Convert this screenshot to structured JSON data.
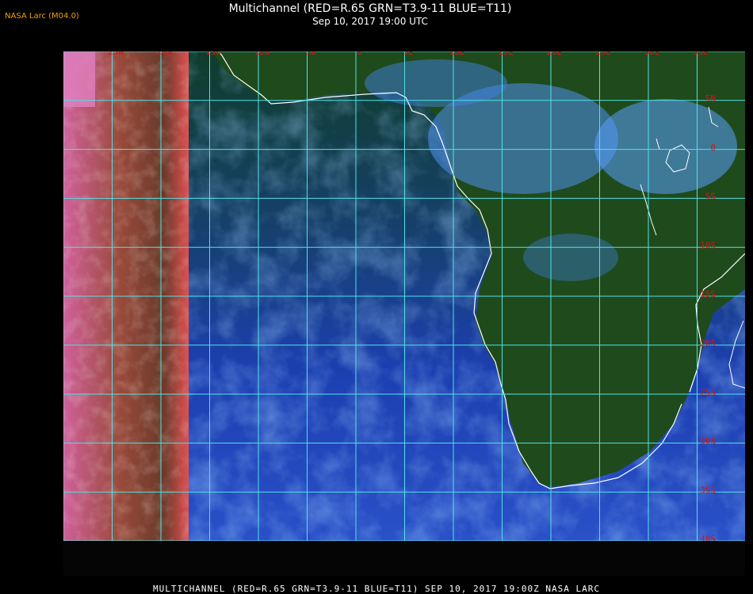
{
  "credit": "NASA Larc (M04.0)",
  "title": "Multichannel (RED=R.65 GRN=T3.9-11 BLUE=T11)",
  "subtitle": "Sep 10, 2017 19:00 UTC",
  "footer": "MULTICHANNEL (RED=R.65 GRN=T3.9-11 BLUE=T11) SEP 10, 2017 19:00Z   NASA LARC",
  "map": {
    "longitude_labels": [
      "25W",
      "20W",
      "15W",
      "10W",
      "5W",
      "0",
      "5E",
      "10E",
      "15E",
      "20E",
      "25E",
      "30E",
      "35E"
    ],
    "latitude_labels": [
      "5N",
      "0",
      "5S",
      "10S",
      "15S",
      "20S",
      "25S",
      "30S",
      "35S",
      "40S"
    ],
    "colors": {
      "grid": "#4fe3e6",
      "label": "#d01818",
      "coastline": "#ffffff",
      "ocean_deep": "#1c3fb0",
      "land": "#1f4a1c",
      "clouds": "#5aa0ff",
      "night_edge": "#c8508a"
    }
  }
}
